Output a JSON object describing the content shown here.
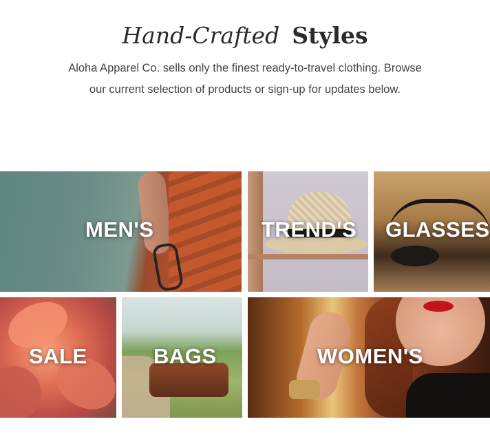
{
  "heading": {
    "italic": "Hand-Crafted",
    "bold": "Styles"
  },
  "intro": {
    "text": "Aloha Apparel Co. sells only the finest ready-to-travel clothing. Browse our current selection of products or sign-up for updates below."
  },
  "categories": [
    {
      "label": "MEN'S"
    },
    {
      "label": "TREND'S"
    },
    {
      "label": "GLASSES"
    },
    {
      "label": "SALE"
    },
    {
      "label": "BAGS"
    },
    {
      "label": "WOMEN'S"
    }
  ]
}
